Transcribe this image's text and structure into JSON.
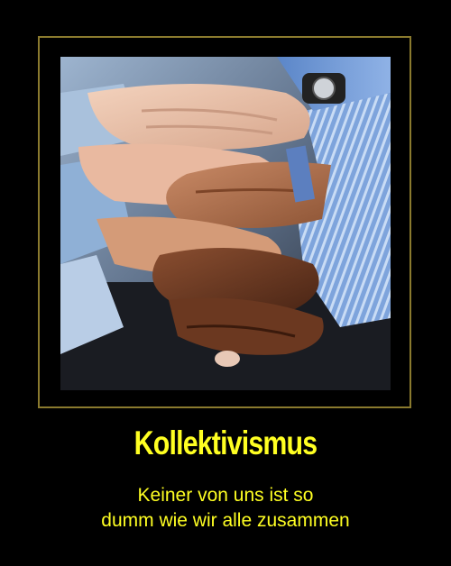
{
  "poster": {
    "title": "Kollektivismus",
    "subtitle_line1": "Keiner von uns ist so",
    "subtitle_line2": "dumm wie wir alle zusammen"
  },
  "photo": {
    "subject": "stacked-hands-icon"
  },
  "colors": {
    "background": "#000000",
    "frame": "#8a7a2e",
    "text": "#ffff22"
  }
}
